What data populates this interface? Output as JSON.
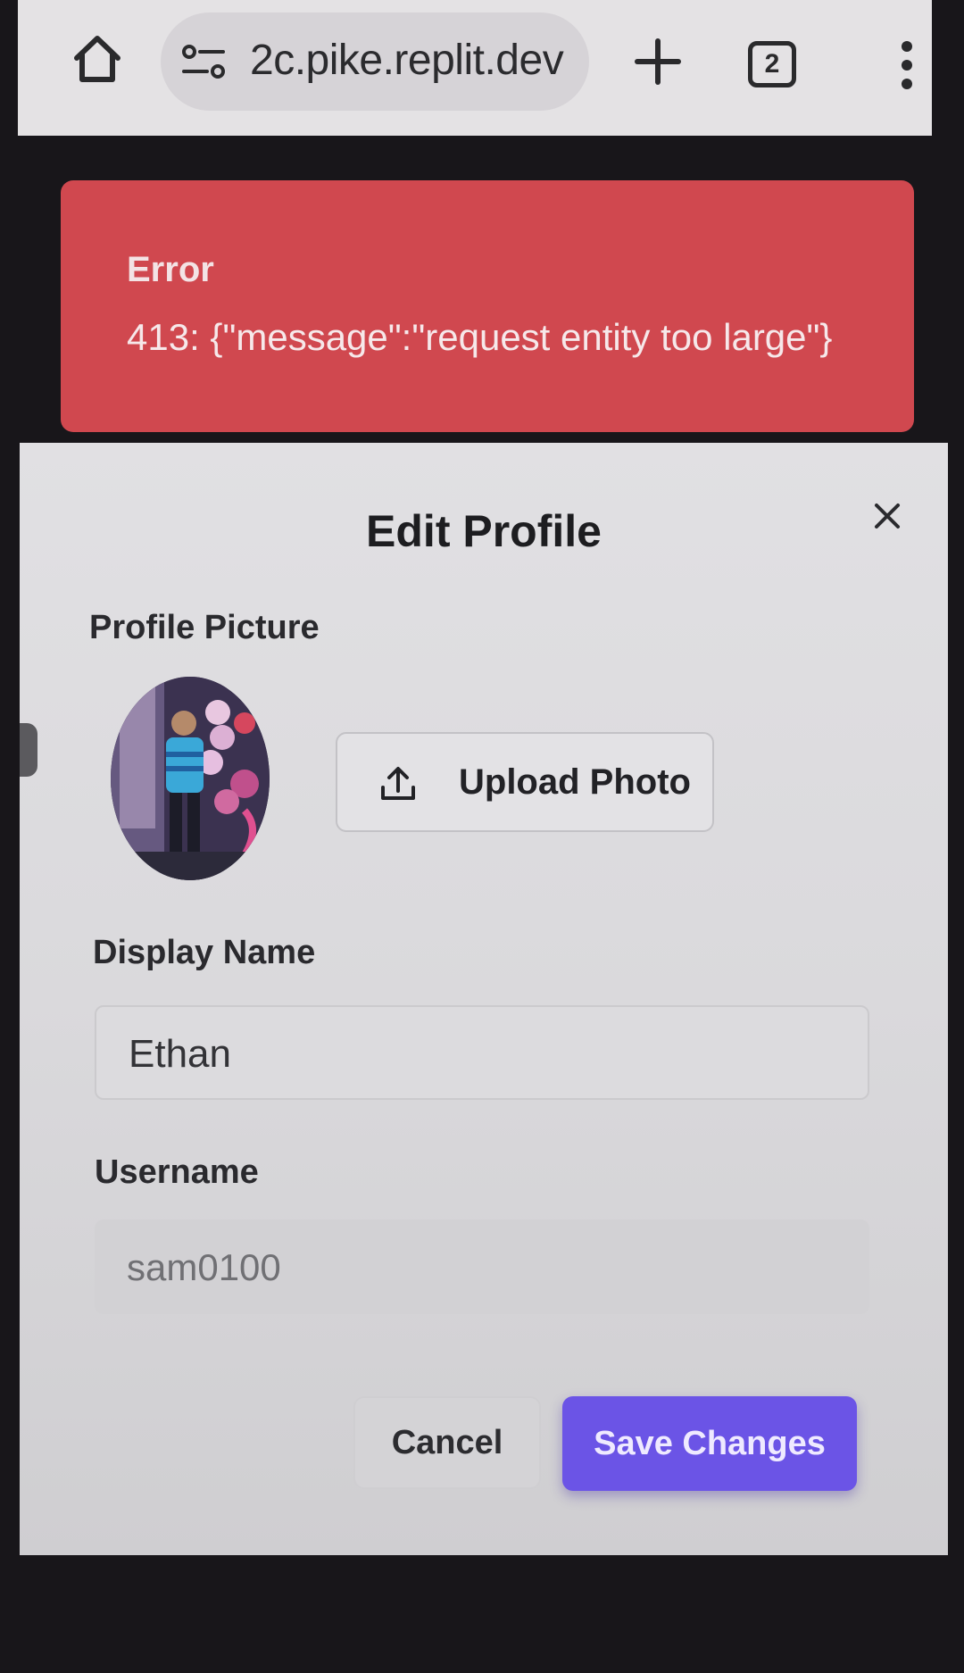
{
  "browser": {
    "url": "2c.pike.replit.dev",
    "tab_count": "2",
    "icons": [
      "home-icon",
      "site-info-icon",
      "plus-icon",
      "tabs-icon",
      "more-vert-icon"
    ]
  },
  "toast": {
    "title": "Error",
    "message": "413: {\"message\":\"request entity too large\"}",
    "color": "#d0484f"
  },
  "dialog": {
    "title": "Edit Profile",
    "profile_picture_label": "Profile Picture",
    "upload_label": "Upload Photo",
    "display_name_label": "Display Name",
    "display_name_value": "Ethan",
    "username_label": "Username",
    "username_value": "sam0100",
    "cancel_label": "Cancel",
    "save_label": "Save Changes",
    "accent_color": "#6b54e6"
  }
}
